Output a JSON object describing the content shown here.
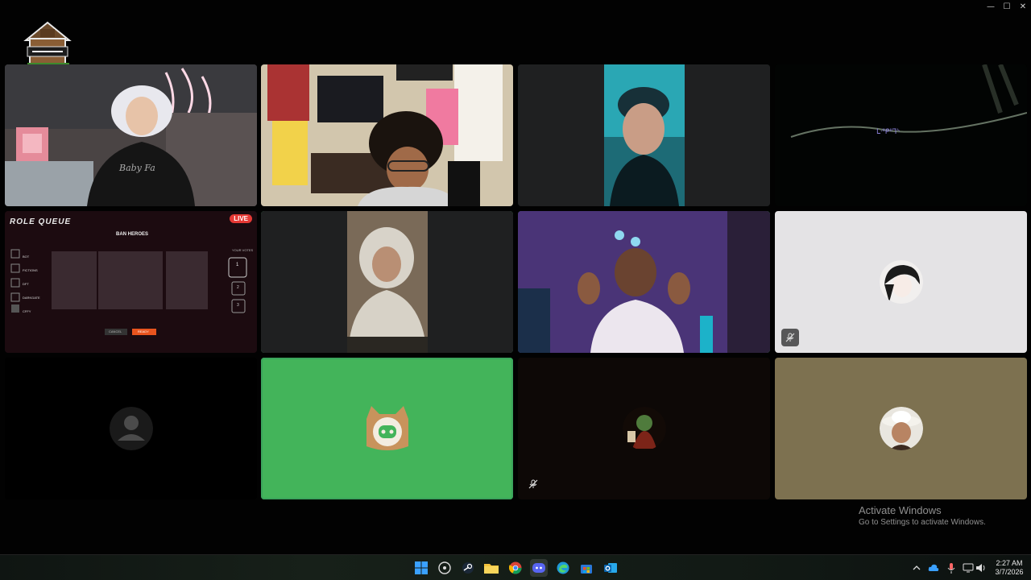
{
  "window": {
    "controls": {
      "minimize": "—",
      "maximize": "☐",
      "close": "✕"
    }
  },
  "logo": {
    "name": "server-logo"
  },
  "tiles": [
    {
      "name": "participant-video-bedroom",
      "kind": "video",
      "speaking": false
    },
    {
      "name": "participant-video-gamer-room",
      "kind": "video",
      "speaking": false
    },
    {
      "name": "participant-video-cap",
      "kind": "video",
      "speaking": false
    },
    {
      "name": "participant-video-dark",
      "kind": "video",
      "speaking": false,
      "overlay_text": "ᒪᐧᐦᑭᐦᒣᔅ"
    },
    {
      "name": "participant-stream-role-queue",
      "kind": "stream",
      "speaking": false,
      "stream": {
        "title": "ROLE QUEUE",
        "live": "LIVE",
        "heading": "BAN HEROES",
        "votes": "YOUR VOTES",
        "players": [
          "BOT",
          "FICTIONS",
          "DFT",
          "DARKGATE",
          "CFFY"
        ],
        "vote_buttons": [
          "1",
          "2",
          "3"
        ],
        "btn_cancel": "CANCEL",
        "btn_ready": "READY"
      }
    },
    {
      "name": "participant-video-hoodie",
      "kind": "video",
      "speaking": true
    },
    {
      "name": "participant-video-purple",
      "kind": "video",
      "speaking": true
    },
    {
      "name": "participant-avatar-anime",
      "kind": "avatar",
      "speaking": false,
      "muted": true
    },
    {
      "name": "participant-avatar-default",
      "kind": "avatar",
      "speaking": false,
      "muted": false
    },
    {
      "name": "participant-avatar-discord-cat",
      "kind": "avatar",
      "speaking": true,
      "muted": false
    },
    {
      "name": "participant-avatar-goblin",
      "kind": "avatar",
      "speaking": false,
      "muted": true
    },
    {
      "name": "participant-avatar-cowboy",
      "kind": "avatar",
      "speaking": false,
      "muted": false
    }
  ],
  "watermark": {
    "title": "Activate Windows",
    "subtitle": "Go to Settings to activate Windows."
  },
  "taskbar": {
    "apps": [
      "windows-start-icon",
      "steam-alt-icon",
      "steam-icon",
      "file-explorer-icon",
      "chrome-icon",
      "discord-icon",
      "edge-icon",
      "store-icon",
      "outlook-icon"
    ],
    "clock_time": "2:27 AM",
    "clock_date": "3/7/2026"
  },
  "colors": {
    "speaking": "#3ba55c",
    "discord_green": "#43b45a",
    "cowboy_bg": "#7d7150"
  }
}
